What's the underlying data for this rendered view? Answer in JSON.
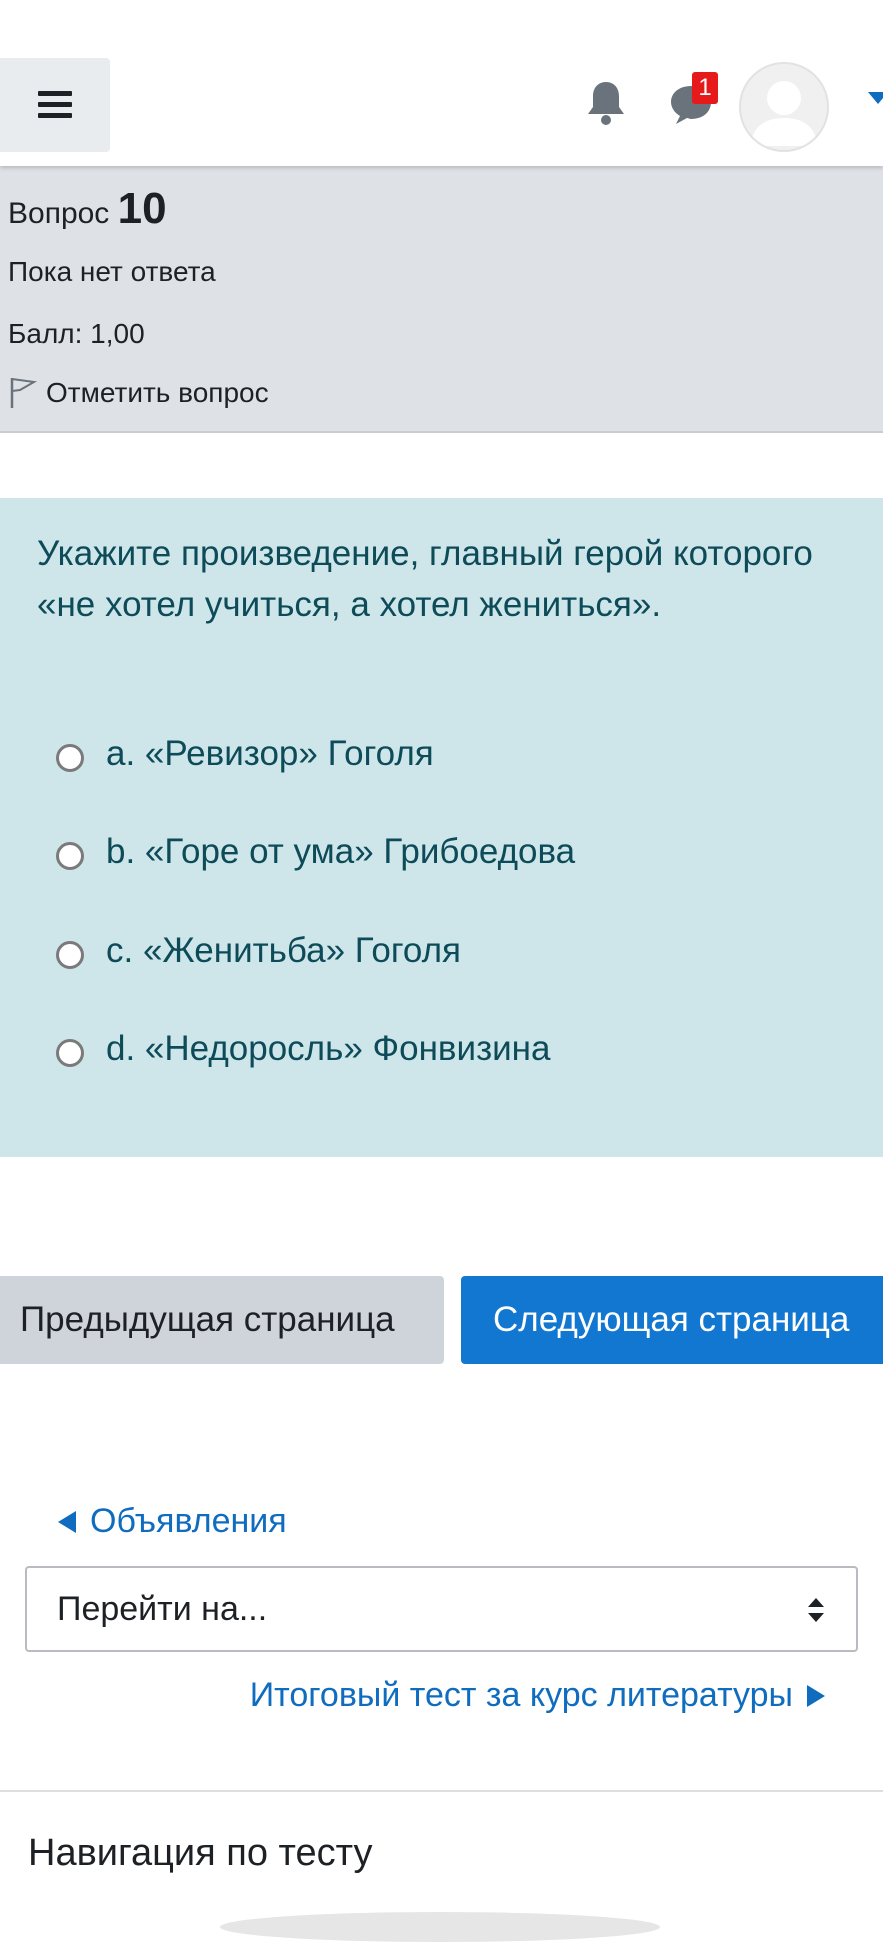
{
  "navbar": {
    "menu_icon": "hamburger-icon",
    "notifications_icon": "bell-icon",
    "messages_icon": "chat-bubble-icon",
    "messages_badge": "1",
    "avatar_icon": "user-avatar-icon",
    "user_menu_icon": "caret-down-icon"
  },
  "question": {
    "label": "Вопрос",
    "number": "10",
    "state": "Пока нет ответа",
    "grade": "Балл: 1,00",
    "flag_label": "Отметить вопрос",
    "text": "Укажите произведение, главный герой которого «не хотел учиться, а хотел жениться».",
    "answers": [
      {
        "label": "a. «Ревизор» Гоголя",
        "selected": false
      },
      {
        "label": "b. «Горе от ума» Грибоедова",
        "selected": false
      },
      {
        "label": "c. «Женитьба» Гоголя",
        "selected": false
      },
      {
        "label": "d. «Недоросль» Фонвизина",
        "selected": false
      }
    ]
  },
  "buttons": {
    "prev_page": "Предыдущая страница",
    "next_page": "Следующая страница"
  },
  "activity_nav": {
    "prev_link": "Объявления",
    "jump_placeholder": "Перейти на...",
    "next_link": "Итоговый тест за курс литературы"
  },
  "quiz_nav": {
    "title": "Навигация по тесту"
  },
  "colors": {
    "accent": "#0f6cbf",
    "primary_button": "#1177d1",
    "question_bg": "#cee6ea",
    "info_bg": "#dee2e6",
    "badge": "#e61a1a"
  }
}
